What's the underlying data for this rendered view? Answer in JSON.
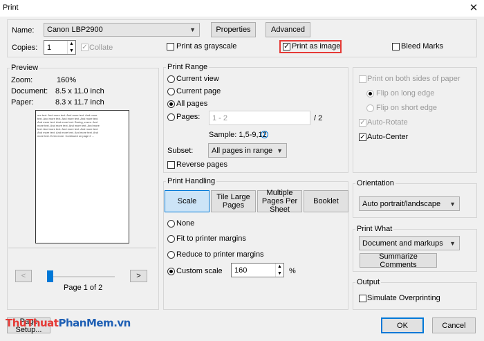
{
  "window": {
    "title": "Print",
    "close_glyph": "✕"
  },
  "header": {
    "name_label": "Name:",
    "printer": "Canon LBP2900",
    "properties_label": "Properties",
    "advanced_label": "Advanced",
    "copies_label": "Copies:",
    "copies_value": "1",
    "collate_label": "Collate",
    "grayscale_label": "Print as grayscale",
    "print_as_image_label": "Print as image",
    "bleed_marks_label": "Bleed Marks"
  },
  "preview": {
    "title": "Preview",
    "zoom_label": "Zoom:",
    "zoom_value": "160%",
    "document_label": "Document:",
    "document_value": "8.5 x 11.0 inch",
    "paper_label": "Paper:",
    "paper_value": "8.3 x 11.7 inch",
    "page_text": "ore text. And more text. And more text. And more text. And more text. And more text. And more text. And more text. And more text. Boring, zzzzz. And more text. And more text. And more text. And more text. And more text. And more text. And more text. And more text. And more text. And more text. And more text. Even more. Continued on page 2 ...",
    "prev_label": "<",
    "next_label": ">",
    "page_indicator": "Page 1 of 2",
    "page_progress": 0.0
  },
  "print_range": {
    "title": "Print Range",
    "current_view": "Current view",
    "current_page": "Current page",
    "all_pages": "All pages",
    "pages_label": "Pages:",
    "pages_placeholder": "1 - 2",
    "pages_total": "/ 2",
    "sample": "Sample: 1,5-9,12",
    "info_glyph": "i",
    "subset_label": "Subset:",
    "subset_value": "All pages in range",
    "reverse_pages": "Reverse pages"
  },
  "print_handling": {
    "title": "Print Handling",
    "tabs": [
      "Scale",
      "Tile Large Pages",
      "Multiple Pages Per Sheet",
      "Booklet"
    ],
    "none": "None",
    "fit": "Fit to printer margins",
    "reduce": "Reduce to printer margins",
    "custom": "Custom scale",
    "custom_value": "160",
    "percent": "%"
  },
  "duplex": {
    "both_sides": "Print on both sides of paper",
    "long_edge": "Flip on long edge",
    "short_edge": "Flip on short edge",
    "auto_rotate": "Auto-Rotate",
    "auto_center": "Auto-Center"
  },
  "orientation": {
    "title": "Orientation",
    "value": "Auto portrait/landscape"
  },
  "print_what": {
    "title": "Print What",
    "value": "Document and markups",
    "summarize_label": "Summarize Comments"
  },
  "output": {
    "title": "Output",
    "simulate_label": "Simulate Overprinting"
  },
  "footer": {
    "page_setup_label": "Page Setup...",
    "ok_label": "OK",
    "cancel_label": "Cancel"
  },
  "watermark": {
    "part1": "ThuThuat",
    "part2": "PhanMem",
    "part3": ".vn"
  },
  "colors": {
    "accent": "#0078d7",
    "highlight": "#e53935"
  },
  "icons": {
    "close": "close-icon",
    "info": "info-icon",
    "dropdown": "chevron-down-icon",
    "check": "check-icon"
  }
}
